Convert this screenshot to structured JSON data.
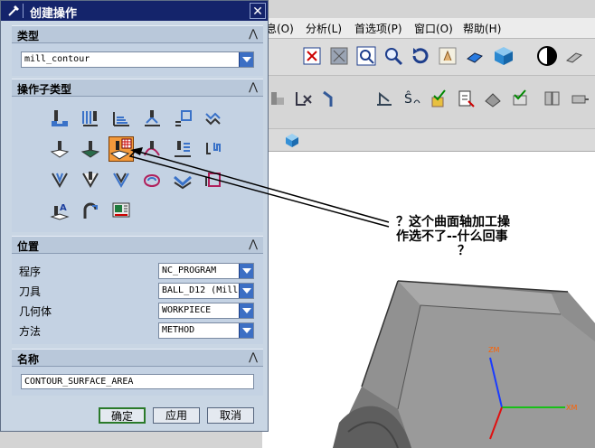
{
  "dialog": {
    "title": "创建操作",
    "close_label": "✕",
    "sections": {
      "type": {
        "title": "类型",
        "collapse_glyph": "⋀",
        "combo_value": "mill_contour"
      },
      "subtype": {
        "title": "操作子类型",
        "collapse_glyph": "⋀"
      },
      "location": {
        "title": "位置",
        "collapse_glyph": "⋀",
        "rows": [
          {
            "label": "程序",
            "value": "NC_PROGRAM"
          },
          {
            "label": "刀具",
            "value": "BALL_D12 (Mill"
          },
          {
            "label": "几何体",
            "value": "WORKPIECE"
          },
          {
            "label": "方法",
            "value": "METHOD"
          }
        ]
      },
      "name": {
        "title": "名称",
        "collapse_glyph": "⋀",
        "value": "CONTOUR_SURFACE_AREA"
      }
    },
    "buttons": {
      "ok": "确定",
      "apply": "应用",
      "cancel": "取消"
    }
  },
  "app": {
    "menus": [
      {
        "label": "息(O)"
      },
      {
        "label": "分析(L)"
      },
      {
        "label": "首选项(P)"
      },
      {
        "label": "窗口(O)"
      },
      {
        "label": "帮助(H)"
      }
    ]
  },
  "annotation": {
    "line1": "？这个曲面轴加工操",
    "line2": "作选不了--什么回事",
    "line3": "？"
  },
  "axes": {
    "z": "ZM",
    "x": "XM"
  },
  "colors": {
    "title_bar": "#14246b",
    "dialog_bg": "#c9d6e4",
    "selected_icon": "#f39a3c"
  }
}
